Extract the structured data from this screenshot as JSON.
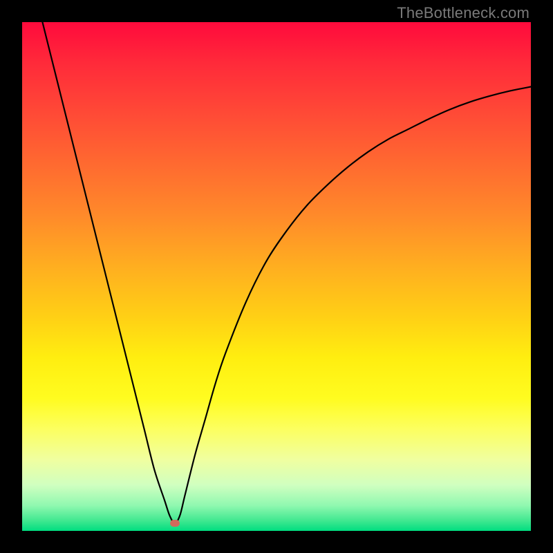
{
  "watermark": "TheBottleneck.com",
  "colors": {
    "frame": "#000000",
    "curve": "#000000",
    "marker": "#d26a5c",
    "gradient_top": "#ff0a3c",
    "gradient_bottom": "#00dd80"
  },
  "chart_data": {
    "type": "line",
    "title": "",
    "xlabel": "",
    "ylabel": "",
    "xlim": [
      0,
      100
    ],
    "ylim": [
      0,
      100
    ],
    "grid": false,
    "legend": false,
    "annotations": [],
    "series": [
      {
        "name": "bottleneck-curve",
        "x": [
          4,
          6,
          8,
          10,
          12,
          14,
          16,
          18,
          20,
          22,
          24,
          26,
          28,
          29,
          30,
          31,
          32,
          34,
          36,
          38,
          40,
          44,
          48,
          52,
          56,
          60,
          64,
          68,
          72,
          76,
          80,
          84,
          88,
          92,
          96,
          100
        ],
        "y": [
          100,
          92,
          84,
          76,
          68,
          60,
          52,
          44,
          36,
          28,
          20,
          12,
          6,
          3,
          1.5,
          3,
          7,
          15,
          22,
          29,
          35,
          45,
          53,
          59,
          64,
          68,
          71.5,
          74.5,
          77,
          79,
          81,
          82.8,
          84.3,
          85.5,
          86.5,
          87.3
        ]
      }
    ],
    "marker": {
      "x": 30,
      "y": 1.5
    }
  }
}
